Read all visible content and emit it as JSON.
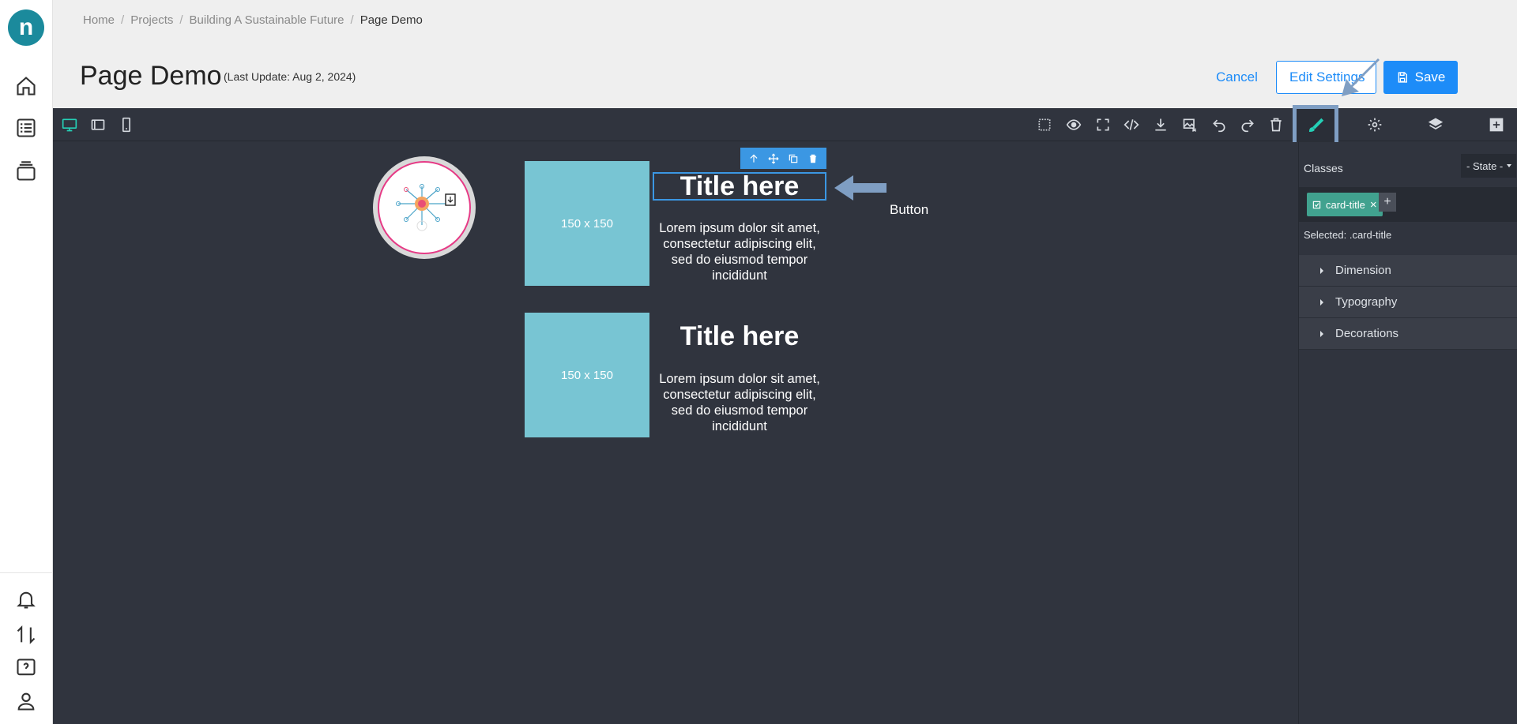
{
  "breadcrumb": {
    "items": [
      "Home",
      "Projects",
      "Building A Sustainable Future"
    ],
    "separator": "/",
    "current": "Page Demo"
  },
  "header": {
    "title": "Page Demo",
    "last_update": "(Last Update: Aug 2, 2024)",
    "cancel_label": "Cancel",
    "edit_label": "Edit Settings",
    "save_label": "Save"
  },
  "sidebar": {
    "logo_text": "n",
    "icons": [
      "home-icon",
      "checklist-icon",
      "layers-icon",
      "bell-icon",
      "transfer-icon",
      "help-icon",
      "user-icon"
    ]
  },
  "canvas": {
    "cards": [
      {
        "placeholder": "150 x 150",
        "title": "Title here",
        "text": "Lorem ipsum dolor sit amet, consectetur adipiscing elit, sed do eiusmod tempor incididunt"
      },
      {
        "placeholder": "150 x 150",
        "title": "Title here",
        "text": "Lorem ipsum dolor sit amet, consectetur adipiscing elit, sed do eiusmod tempor incididunt"
      }
    ],
    "note": "Button"
  },
  "style_panel": {
    "classes_label": "Classes",
    "state_label": "- State -",
    "tag": "card-title",
    "tag_remove": "×",
    "add": "+",
    "selected_label": "Selected:",
    "selected_value": ".card-title",
    "sectors": [
      "Dimension",
      "Typography",
      "Decorations"
    ]
  },
  "colors": {
    "accent": "#1d8cf8",
    "editor_bg": "#30343e",
    "active_tool": "#25d0b6",
    "placeholder": "#78c5d3",
    "tag": "#41a28f",
    "annotation_arrow": "#7f9ec3"
  }
}
